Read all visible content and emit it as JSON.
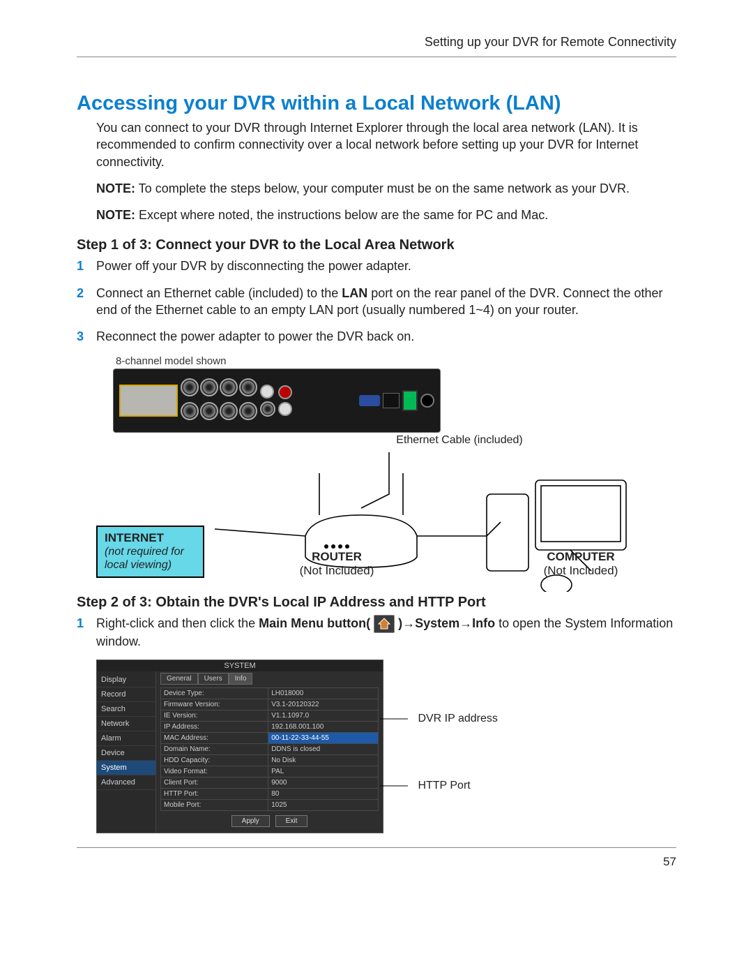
{
  "header": "Setting up your DVR for Remote Connectivity",
  "page_number": "57",
  "h1": "Accessing your DVR within a Local Network (LAN)",
  "intro": "You can connect to your DVR through Internet Explorer through the local area network (LAN). It is recommended to confirm connectivity over a local network before setting up your DVR for Internet connectivity.",
  "note1_prefix": "NOTE:",
  "note1": " To complete the steps below, your computer must be on the same network as your DVR.",
  "note2_prefix": "NOTE:",
  "note2": " Except where noted, the instructions below are the same for PC and Mac.",
  "step1_heading": "Step 1 of 3: Connect your DVR to the Local Area Network",
  "step1_items": {
    "i1": "Power off your DVR by disconnecting the power adapter.",
    "i2a": "Connect an Ethernet cable (included) to the ",
    "i2b": "LAN",
    "i2c": " port on the rear panel of the DVR. Connect the other end of the Ethernet cable to an empty LAN port (usually numbered 1~4) on your router.",
    "i3": "Reconnect the power adapter to power the DVR back on."
  },
  "diagram": {
    "caption_small": "8-channel model shown",
    "ethernet_label": "Ethernet Cable (included)",
    "internet": {
      "title": "INTERNET",
      "sub": "(not required for local viewing)"
    },
    "router": {
      "title": "ROUTER",
      "sub": "(Not Included)"
    },
    "computer": {
      "title": "COMPUTER",
      "sub": "(Not Included)"
    }
  },
  "step2_heading": "Step 2 of 3: Obtain the DVR's Local IP Address and HTTP Port",
  "step2_items": {
    "i1a": "Right-click and then click the ",
    "i1b": "Main Menu button( ",
    "i1c": " )→System→Info",
    "i1d": " to open the System Information window."
  },
  "callout_ip": "DVR IP address",
  "callout_port": "HTTP Port",
  "system_window": {
    "title": "SYSTEM",
    "sidebar": [
      "Display",
      "Record",
      "Search",
      "Network",
      "Alarm",
      "Device",
      "System",
      "Advanced"
    ],
    "sidebar_selected": "System",
    "tabs": [
      "General",
      "Users",
      "Info"
    ],
    "tab_selected": "Info",
    "rows": [
      {
        "label": "Device Type:",
        "value": "LH018000"
      },
      {
        "label": "Firmware Version:",
        "value": "V3.1-20120322"
      },
      {
        "label": "IE Version:",
        "value": "V1.1.1097.0"
      },
      {
        "label": "IP Address:",
        "value": "192.168.001.100",
        "hl": false
      },
      {
        "label": "MAC Address:",
        "value": "00-11-22-33-44-55",
        "hl": true
      },
      {
        "label": "Domain Name:",
        "value": "DDNS is closed"
      },
      {
        "label": "HDD Capacity:",
        "value": "No Disk"
      },
      {
        "label": "Video Format:",
        "value": "PAL"
      },
      {
        "label": "Client Port:",
        "value": "9000"
      },
      {
        "label": "HTTP Port:",
        "value": "80"
      },
      {
        "label": "Mobile Port:",
        "value": "1025"
      }
    ],
    "buttons": [
      "Apply",
      "Exit"
    ]
  }
}
